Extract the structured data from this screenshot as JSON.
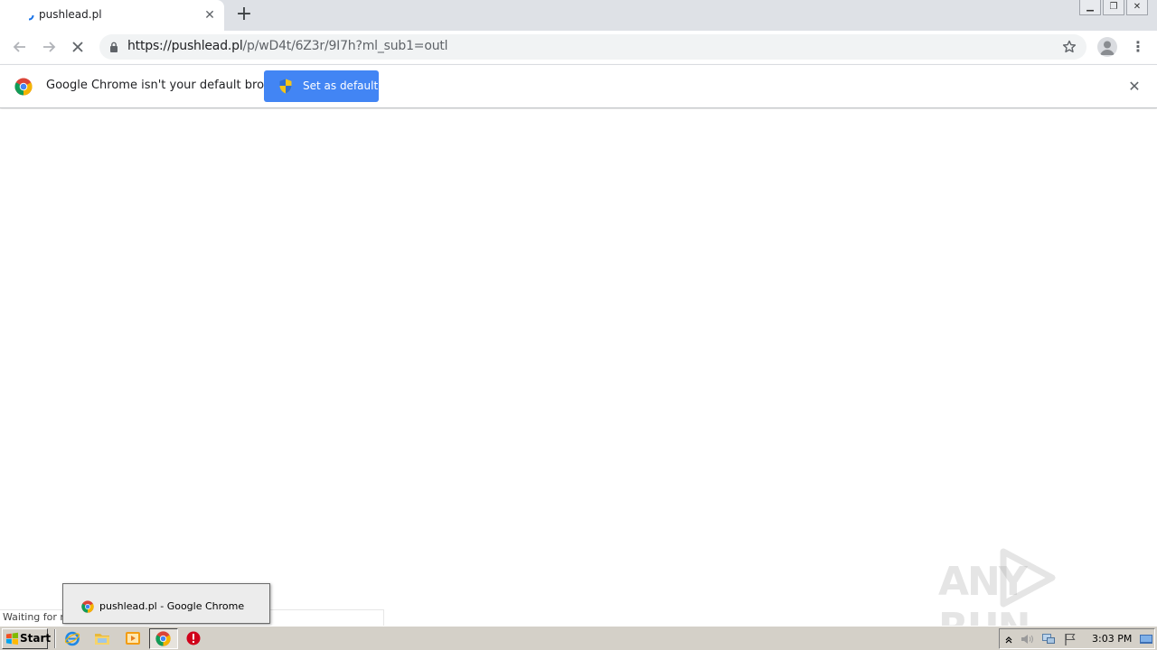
{
  "browser": {
    "tab": {
      "title": "pushlead.pl",
      "close_label": "✕"
    },
    "new_tab_label": "+",
    "window_buttons": {
      "minimize": "▁",
      "restore": "❐",
      "close": "✕"
    },
    "toolbar": {
      "back_icon": "back-arrow-icon",
      "forward_icon": "forward-arrow-icon",
      "stop_icon": "stop-icon",
      "url_host": "https://pushlead.pl",
      "url_path": "/p/wD4t/6Z3r/9I7h?ml_sub1=outl",
      "bookmark_icon": "star-icon",
      "menu_label": "⋮"
    },
    "infobar": {
      "message": "Google Chrome isn't your default browser",
      "button_label": "Set as default",
      "close_label": "✕"
    },
    "status_text": "Waiting for ng"
  },
  "watermark": {
    "text": "ANY RUN"
  },
  "taskbar": {
    "start_label": "Start",
    "preview_label": "pushlead.pl - Google Chrome",
    "clock": "3:03 PM",
    "pinned": [
      "internet-explorer-icon",
      "explorer-folder-icon",
      "media-player-icon",
      "chrome-icon",
      "stop-sign-icon"
    ],
    "tray": [
      "show-hidden-icon",
      "volume-icon",
      "network-icon",
      "action-center-flag-icon",
      "show-desktop-icon"
    ]
  },
  "colors": {
    "accent": "#4285f4",
    "tabstrip": "#dee1e6",
    "taskbar": "#d4d0c8"
  }
}
